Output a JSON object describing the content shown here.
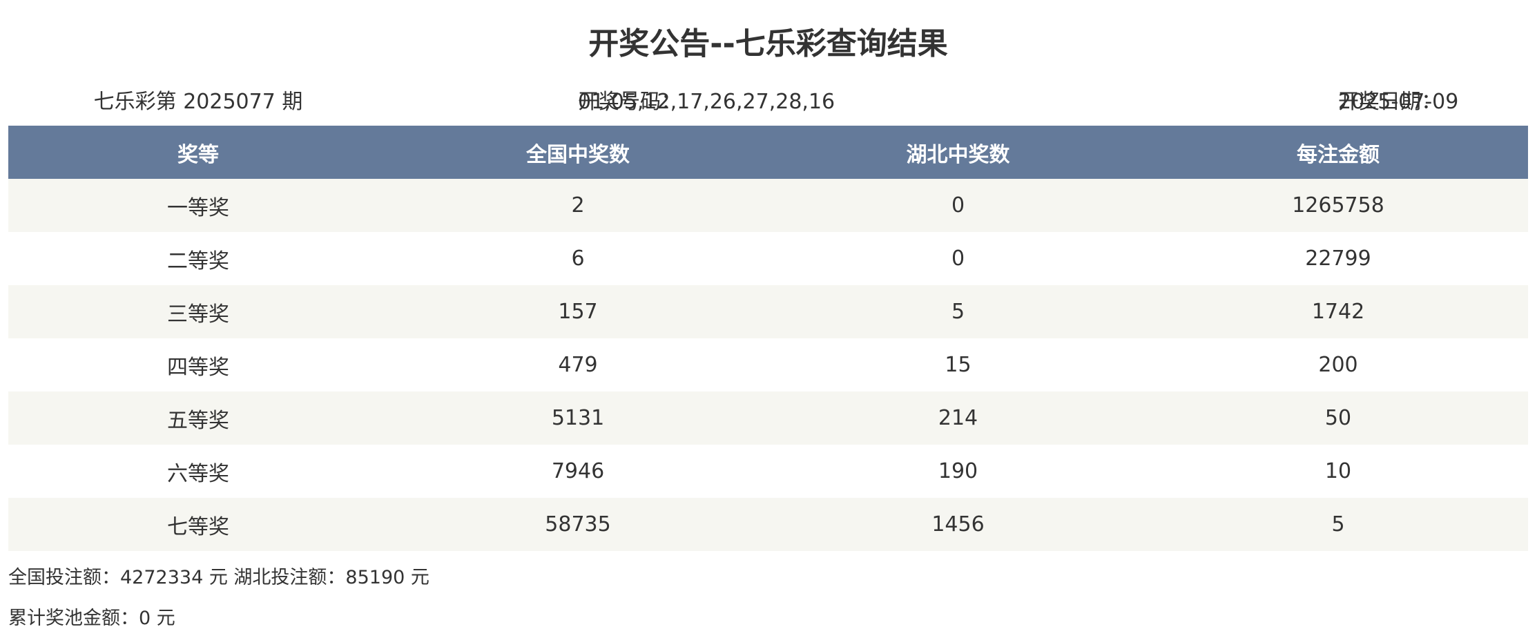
{
  "title": "开奖公告--七乐彩查询结果",
  "issue": {
    "prefix": "七乐彩第 ",
    "number": "2025077",
    "suffix": " 期"
  },
  "winning_numbers": {
    "label": "开奖号码：",
    "value": "01,05,12,17,26,27,28,16"
  },
  "draw_date": {
    "label": "开奖日期：",
    "value": "2025-07-09"
  },
  "table": {
    "headers": [
      "奖等",
      "全国中奖数",
      "湖北中奖数",
      "每注金额"
    ],
    "rows": [
      [
        "一等奖",
        "2",
        "0",
        "1265758"
      ],
      [
        "二等奖",
        "6",
        "0",
        "22799"
      ],
      [
        "三等奖",
        "157",
        "5",
        "1742"
      ],
      [
        "四等奖",
        "479",
        "15",
        "200"
      ],
      [
        "五等奖",
        "5131",
        "214",
        "50"
      ],
      [
        "六等奖",
        "7946",
        "190",
        "10"
      ],
      [
        "七等奖",
        "58735",
        "1456",
        "5"
      ]
    ]
  },
  "sales": {
    "national_label": "全国投注额：",
    "national_value": "4272334",
    "national_unit": " 元 ",
    "hubei_label": "湖北投注额：",
    "hubei_value": "85190",
    "hubei_unit": " 元"
  },
  "pool": {
    "label": "累计奖池金额：",
    "value": "0",
    "unit": " 元"
  },
  "colors": {
    "header_bg": "#647a9a",
    "header_text": "#ffffff",
    "odd_row_bg": "#f6f6f1",
    "even_row_bg": "#ffffff",
    "text": "#333333"
  }
}
